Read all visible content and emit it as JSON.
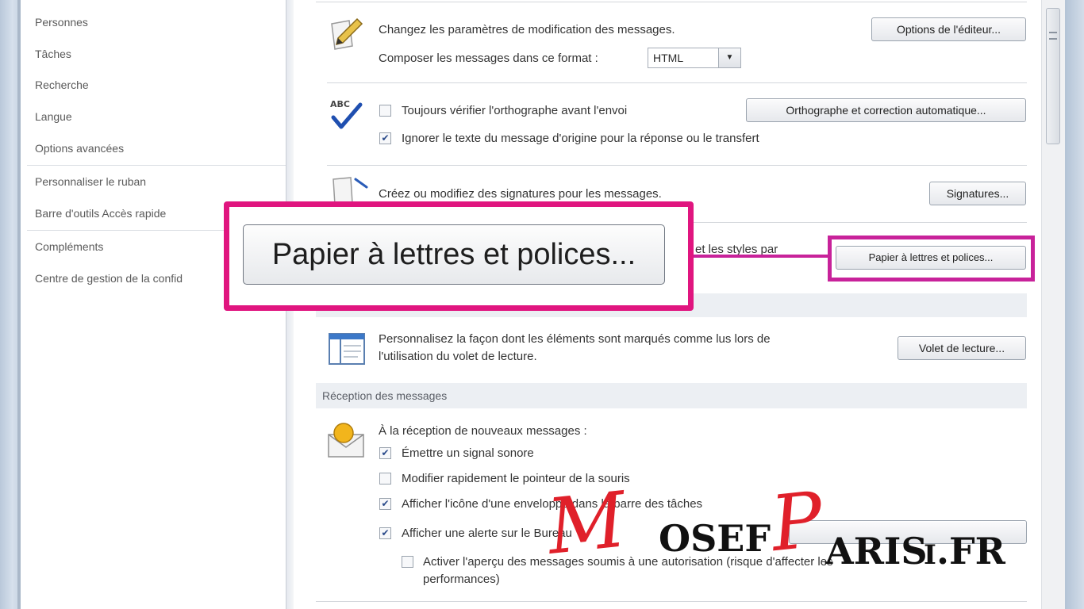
{
  "sidebar": {
    "items": [
      {
        "label": "Personnes"
      },
      {
        "label": "Tâches"
      },
      {
        "label": "Recherche"
      },
      {
        "label": "Langue"
      },
      {
        "label": "Options avancées"
      },
      {
        "label": "Personnaliser le ruban"
      },
      {
        "label": "Barre d'outils Accès rapide"
      },
      {
        "label": "Compléments"
      },
      {
        "label": "Centre de gestion de la confid"
      }
    ]
  },
  "compose": {
    "editor_text": "Changez les paramètres de modification des messages.",
    "editor_button": "Options de l'éditeur...",
    "format_label": "Composer les messages dans ce format :",
    "format_value": "HTML"
  },
  "spelling": {
    "always_check": "Toujours vérifier l'orthographe avant l'envoi",
    "always_check_checked": false,
    "ignore_original": "Ignorer le texte du message d'origine pour la réponse ou le transfert",
    "ignore_original_checked": true,
    "button": "Orthographe et correction automatique...",
    "icon_text": "ABC"
  },
  "signatures": {
    "text": "Créez ou modifiez des signatures pour les messages.",
    "button": "Signatures..."
  },
  "stationery": {
    "text_fragment": "et les styles par",
    "button": "Papier à lettres et polices...",
    "callout_button": "Papier à lettres et polices..."
  },
  "reading_pane": {
    "text_line1": "Personnalisez la façon dont les éléments sont marqués comme lus lors de",
    "text_line2": "l'utilisation du volet de lecture.",
    "button": "Volet de lecture..."
  },
  "receipt": {
    "header": "Réception des messages",
    "intro": "À la réception de nouveaux messages :",
    "options": [
      {
        "label": "Émettre un signal sonore",
        "checked": true
      },
      {
        "label": "Modifier rapidement le pointeur de la souris",
        "checked": false
      },
      {
        "label": "Afficher l'icône d'une enveloppe dans la barre des tâches",
        "checked": true
      },
      {
        "label": "Afficher une alerte sur le Bureau",
        "checked": true
      }
    ],
    "preview_line1": "Activer l'aperçu des messages soumis à une autorisation (risque d'affecter les",
    "preview_line2": "performances)",
    "preview_checked": false
  },
  "watermark": {
    "m": "M",
    "osef": "OSEF",
    "p": "P",
    "aris": "ARIS",
    "i": "I",
    "fr": ".FR"
  },
  "colors": {
    "callout_border": "#e0157f",
    "highlight_border": "#c8229a",
    "watermark_red": "#e0202a"
  }
}
